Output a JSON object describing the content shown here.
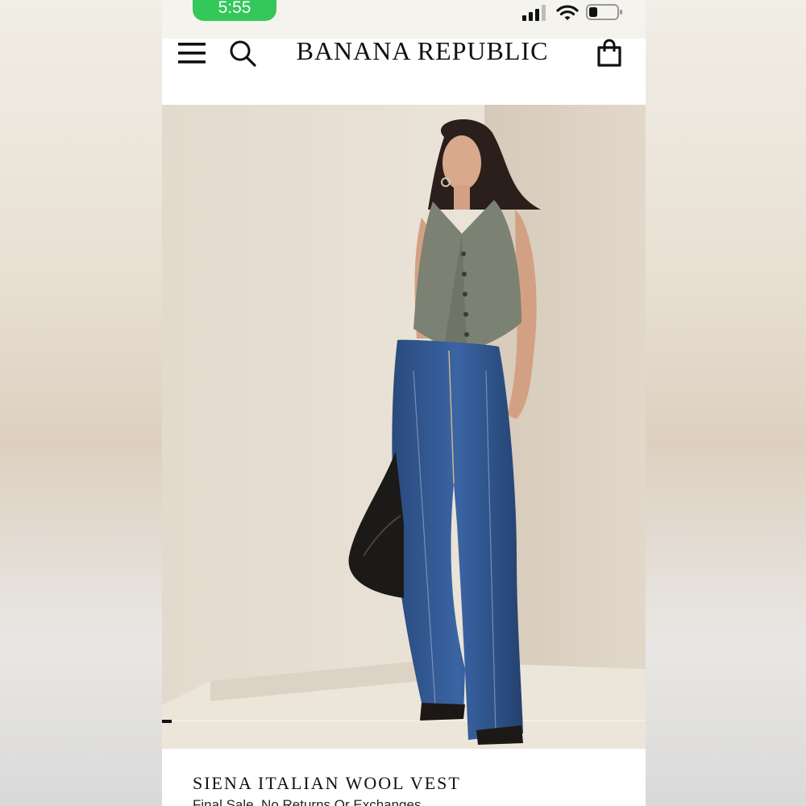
{
  "status_bar": {
    "time": "5:55",
    "icons": [
      "cellular-signal-icon",
      "wifi-icon",
      "battery-icon"
    ]
  },
  "header": {
    "brand": "BANANA REPUBLIC",
    "icons": [
      "menu-icon",
      "search-icon",
      "shopping-bag-icon"
    ]
  },
  "product": {
    "name": "SIENA ITALIAN WOOL VEST",
    "note": "Final Sale, No Returns Or Exchanges"
  },
  "colors": {
    "status_pill": "#34c759",
    "background": "#ffffff",
    "text": "#111111"
  }
}
